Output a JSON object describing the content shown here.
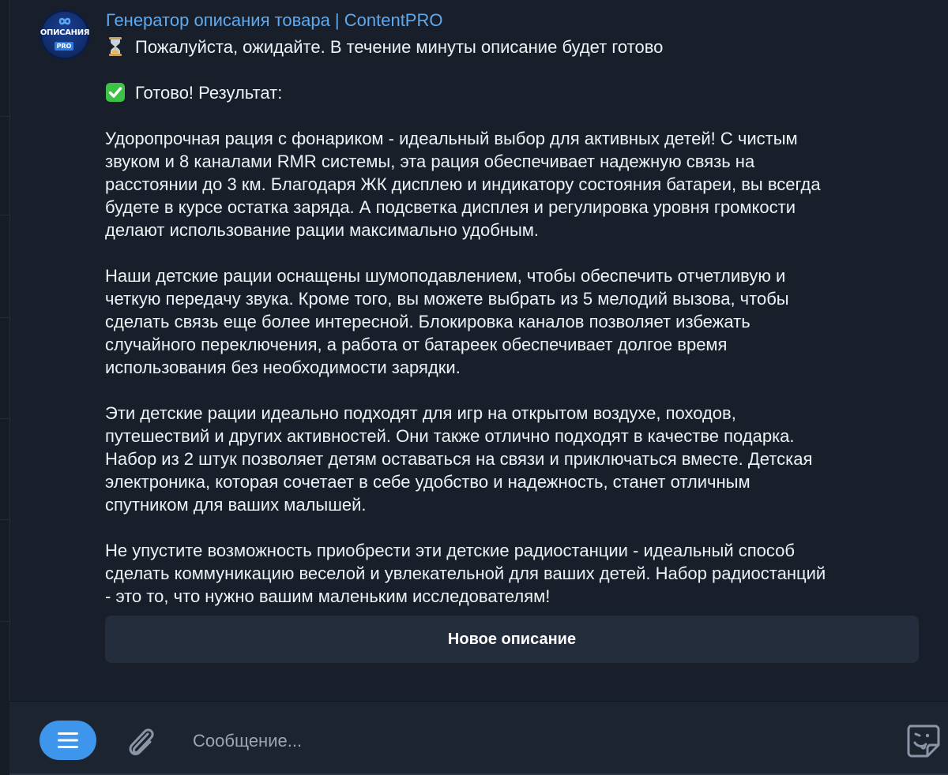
{
  "bot": {
    "avatar_text": "ОПИСАНИЯ",
    "avatar_badge": "PRO",
    "sender_name": "Генератор описания товара | ContentPRO"
  },
  "message": {
    "waiting_text": "Пожалуйста, ожидайте. В течение минуты описание будет готово",
    "ready_text": "Готово! Результат:",
    "paragraphs": [
      "Удоропрочная рация с фонариком - идеальный выбор для активных детей! С чистым\nзвуком и 8 каналами RMR системы, эта рация обеспечивает надежную связь на\nрасстоянии до 3 км. Благодаря ЖК дисплею и индикатору состояния батареи, вы всегда\nбудете в курсе остатка заряда. А подсветка дисплея и регулировка уровня громкости\nделают использование рации максимально удобным.",
      "Наши детские рации оснащены шумоподавлением, чтобы обеспечить отчетливую и\nчеткую передачу звука. Кроме того, вы можете выбрать из 5 мелодий вызова, чтобы\nсделать связь еще более интересной. Блокировка каналов позволяет избежать\nслучайного переключения, а работа от батареек обеспечивает долгое время\nиспользования без необходимости зарядки.",
      "Эти детские рации идеально подходят для игр на открытом воздухе, походов,\nпутешествий и других активностей. Они также отлично подходят в качестве подарка.\nНабор из 2 штук позволяет детям оставаться на связи и приключаться вместе. Детская\nэлектроника, которая сочетает в себе удобство и надежность, станет отличным\nспутником для ваших малышей.",
      "Не упустите возможность приобрести эти детские радиостанции - идеальный способ\nсделать коммуникацию веселой и увлекательной для ваших детей. Набор радиостанций\n- это то, что нужно вашим маленьким исследователям!"
    ],
    "icons": {
      "waiting": "hourglass-icon",
      "ready": "check-mark-icon"
    }
  },
  "keyboard": {
    "button_label": "Новое описание"
  },
  "composer": {
    "placeholder": "Сообщение...",
    "icons": [
      "menu-icon",
      "paperclip-icon",
      "sticker-icon"
    ]
  },
  "colors": {
    "background": "#181f2a",
    "sender_name": "#5fa9ee",
    "menu_button": "#3e95ec",
    "check_mark": "#3cc245",
    "keyboard_button": "#232d3b"
  }
}
